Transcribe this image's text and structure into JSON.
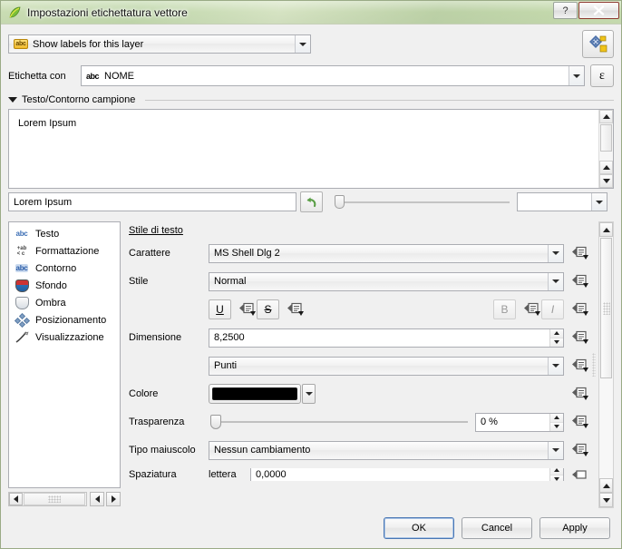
{
  "window": {
    "title": "Impostazioni etichettatura vettore",
    "icon": "qgis-leaf-icon",
    "help_label": "?",
    "close_label": "✕"
  },
  "header": {
    "labeling_mode": "Show labels for this layer",
    "labeling_mode_icon": "abc-yellow-icon",
    "settings_button_icon": "labeling-options-icon",
    "label_with_caption": "Etichetta con",
    "label_with_field": "NOME",
    "label_with_field_icon": "abc-text-field-icon",
    "expression_button": "ε"
  },
  "sample_group": {
    "title": "Testo/Contorno campione",
    "preview_text": "Lorem Ipsum",
    "sample_input_value": "Lorem Ipsum",
    "revert_icon": "revert-arrow-icon",
    "zoom_value": ""
  },
  "sidebar": {
    "items": [
      {
        "label": "Testo",
        "icon": "abc-text-icon"
      },
      {
        "label": "Formattazione",
        "icon": "formatting-icon"
      },
      {
        "label": "Contorno",
        "icon": "abc-buffer-icon"
      },
      {
        "label": "Sfondo",
        "icon": "background-shield-icon"
      },
      {
        "label": "Ombra",
        "icon": "shadow-shield-icon"
      },
      {
        "label": "Posizionamento",
        "icon": "placement-diamonds-icon"
      },
      {
        "label": "Visualizzazione",
        "icon": "rendering-brush-icon"
      }
    ]
  },
  "panel": {
    "section_title": "Stile di testo",
    "fields": {
      "font_label": "Carattere",
      "font_value": "MS Shell Dlg 2",
      "style_label": "Stile",
      "style_value": "Normal",
      "underline_btn": "U",
      "strikeout_btn": "S",
      "bold_btn": "B",
      "italic_btn": "I",
      "size_label": "Dimensione",
      "size_value": "8,2500",
      "size_unit_value": "Punti",
      "color_label": "Colore",
      "color_value": "#000000",
      "transparency_label": "Trasparenza",
      "transparency_value": "0 %",
      "case_label": "Tipo maiuscolo",
      "case_value": "Nessun cambiamento",
      "spacing_label": "Spaziatura",
      "spacing_sub_label": "lettera",
      "spacing_value": "0,0000"
    },
    "override_icon": "data-defined-override-icon"
  },
  "footer": {
    "ok": "OK",
    "cancel": "Cancel",
    "apply": "Apply"
  },
  "colors": {
    "accent": "#7aad4b",
    "text_color": "#000000",
    "close_red": "#c9503c"
  }
}
